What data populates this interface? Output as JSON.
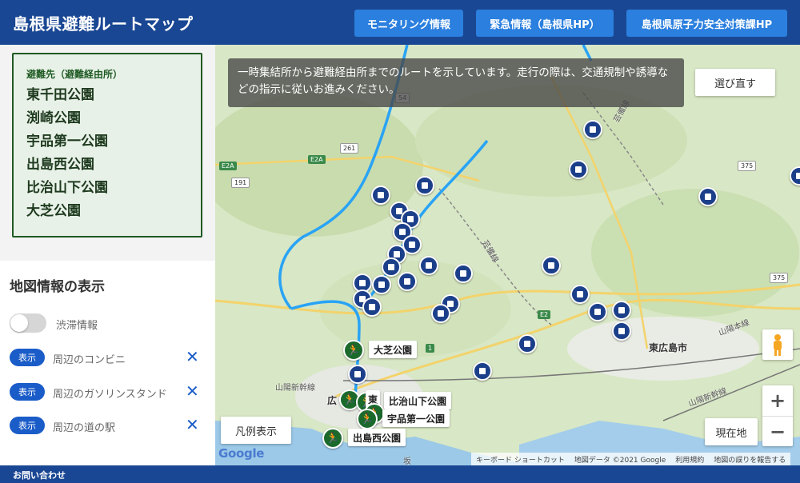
{
  "header": {
    "title": "島根県避難ルートマップ",
    "buttons": [
      "モニタリング情報",
      "緊急情報（島根県HP）",
      "島根県原子力安全対策課HP"
    ]
  },
  "destinations": {
    "heading": "避難先（避難経由所）",
    "items": [
      "東千田公園",
      "渕崎公園",
      "宇品第一公園",
      "出島西公園",
      "比治山下公園",
      "大芝公園"
    ]
  },
  "map_info": {
    "title": "地図情報の表示",
    "traffic_label": "渋滞情報",
    "show_label": "表示",
    "layers": [
      "周辺のコンビニ",
      "周辺のガソリンスタンド",
      "周辺の道の駅"
    ]
  },
  "footer": {
    "contact": "お問い合わせ"
  },
  "map": {
    "notice": "一時集結所から避難経由所までのルートを示しています。走行の際は、交通規制や誘導などの指示に従いお進みください。",
    "reselect": "選び直す",
    "legend": "凡例表示",
    "current_location": "現在地",
    "zoom_in": "+",
    "zoom_out": "−",
    "google": "Google",
    "attribution": [
      "キーボード ショートカット",
      "地図データ ©2021 Google",
      "利用規約",
      "地図の誤りを報告する"
    ],
    "city_labels": [
      "東広島市",
      "広"
    ],
    "road_labels": [
      "芸備線",
      "芸備線",
      "山陽本線",
      "山陽新幹線",
      "山陽新幹線",
      "坂"
    ],
    "shields": [
      "E2A",
      "191",
      "261",
      "E2A",
      "54",
      "375",
      "2",
      "375",
      "E2",
      "1"
    ],
    "place_labels": [
      "大芝公園",
      "比治山下公園",
      "宇品第一公園",
      "出島西公園",
      "東"
    ],
    "route_color": "#29a3f5",
    "pin_color_shelter": "#1b6a2c",
    "pin_color_facility": "#1c3f8a",
    "walk_icon": "🏃"
  }
}
